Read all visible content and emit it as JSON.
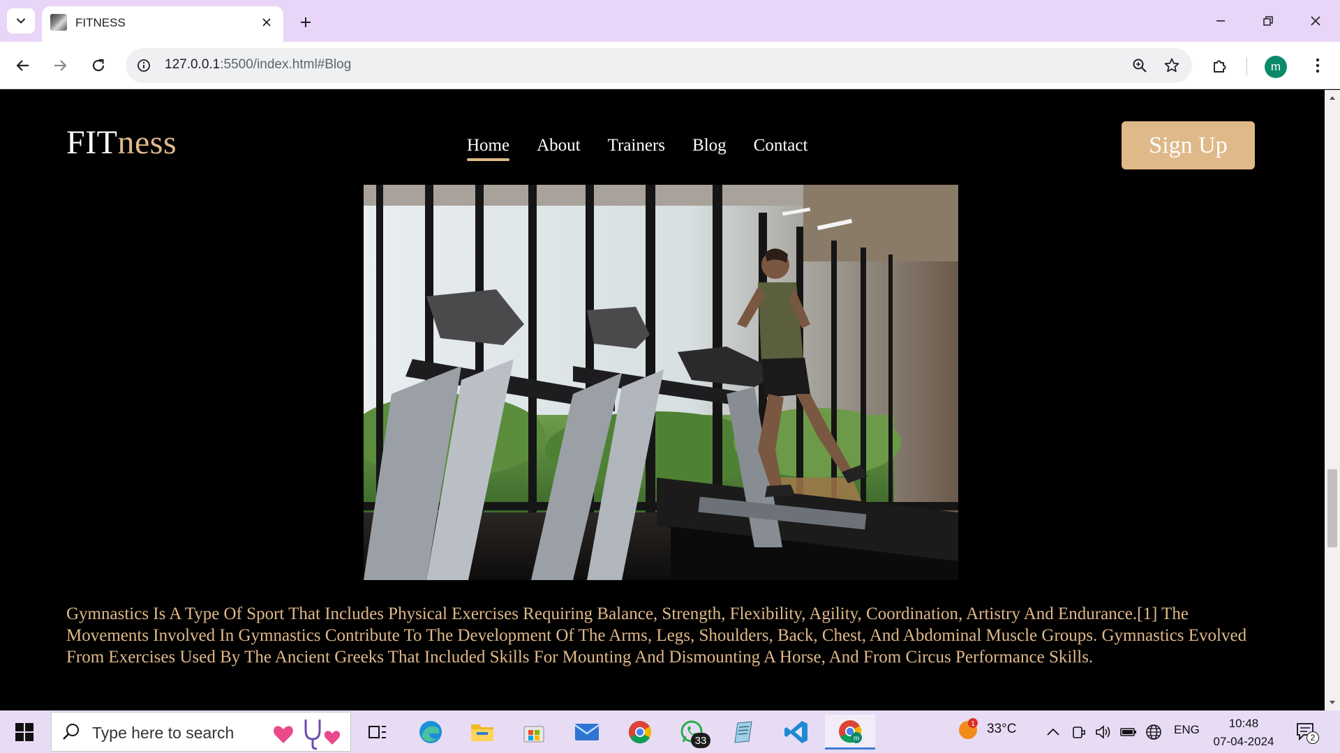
{
  "browser": {
    "tab_title": "FITNESS",
    "url_host": "127.0.0.1",
    "url_rest": ":5500/index.html#Blog",
    "profile_initial": "m",
    "colors": {
      "tabstrip": "#e9d5f7",
      "omnibox": "#eef0f2",
      "profile": "#0b8a6a"
    }
  },
  "site": {
    "logo_main": "FIT",
    "logo_accent": "ness",
    "nav": [
      {
        "label": "Home",
        "active": true
      },
      {
        "label": "About",
        "active": false
      },
      {
        "label": "Trainers",
        "active": false
      },
      {
        "label": "Blog",
        "active": false
      },
      {
        "label": "Contact",
        "active": false
      }
    ],
    "signup_label": "Sign Up",
    "accent_color": "#e0b98a",
    "background": "#000000",
    "hero_image": "gym-treadmill-photo",
    "blog_text": "Gymnastics Is A Type Of Sport That Includes Physical Exercises Requiring Balance, Strength, Flexibility, Agility, Coordination, Artistry And Endurance.[1] The Movements Involved In Gymnastics Contribute To The Development Of The Arms, Legs, Shoulders, Back, Chest, And Abdominal Muscle Groups. Gymnastics Evolved From Exercises Used By The Ancient Greeks That Included Skills For Mounting And Dismounting A Horse, And From Circus Performance Skills."
  },
  "taskbar": {
    "search_placeholder": "Type here to search",
    "apps": [
      "task-view",
      "edge",
      "file-explorer",
      "microsoft-store",
      "mail",
      "chrome",
      "whatsapp",
      "notepad",
      "vscode",
      "chrome-profile"
    ],
    "whatsapp_badge": "33",
    "weather_temp": "33°C",
    "weather_badge": "1",
    "language": "ENG",
    "time": "10:48",
    "date": "07-04-2024",
    "notification_count": "2"
  }
}
